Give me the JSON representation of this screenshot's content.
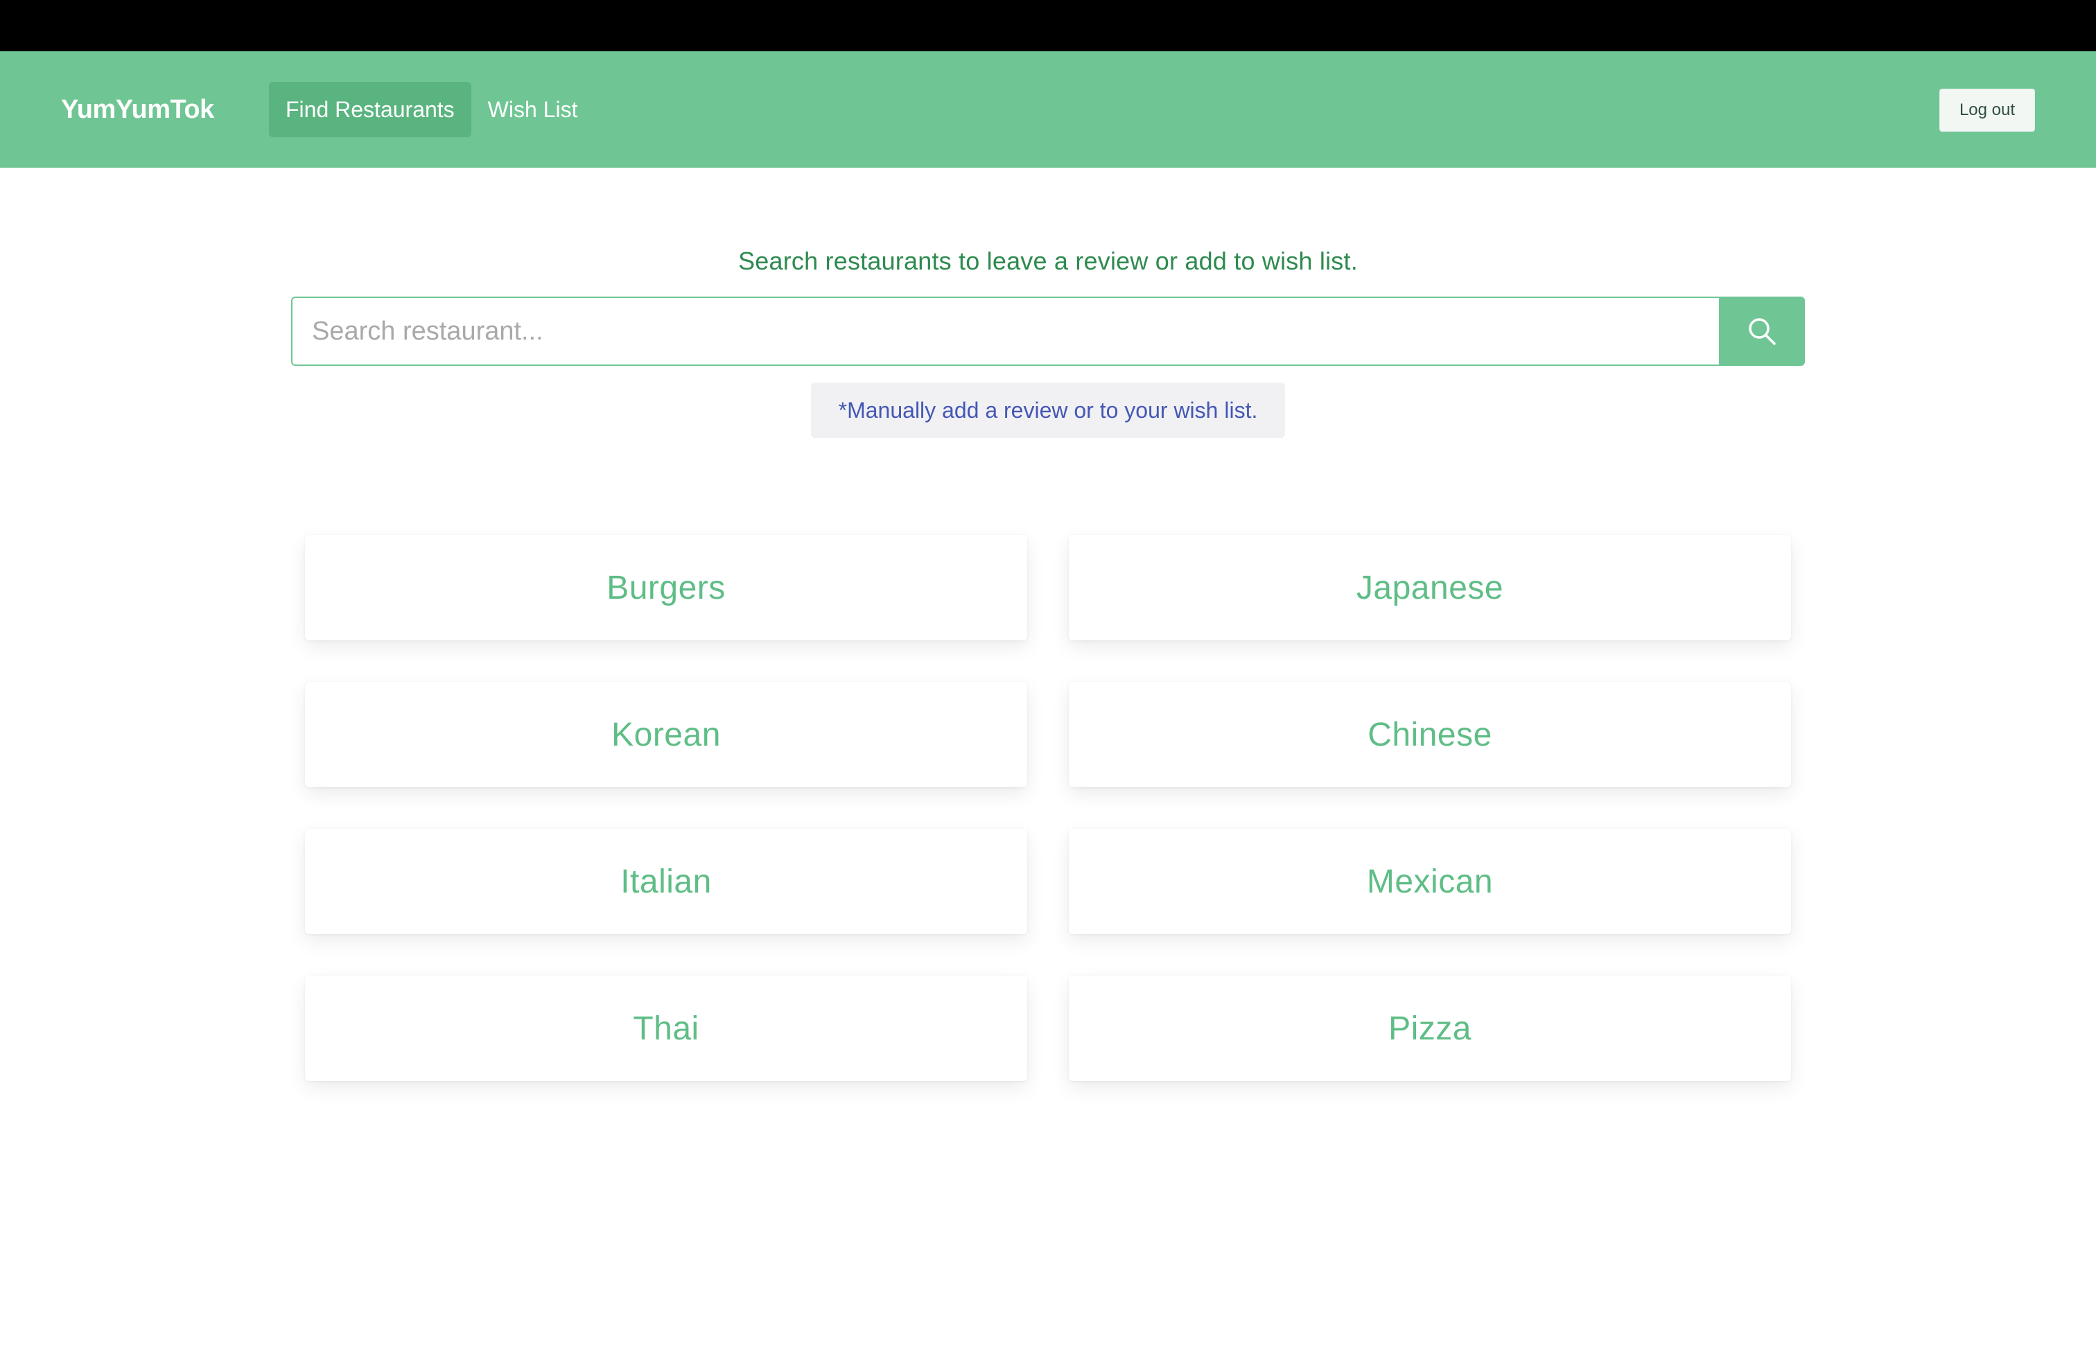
{
  "navbar": {
    "brand": "YumYumTok",
    "links": [
      {
        "label": "Find Restaurants",
        "active": true
      },
      {
        "label": "Wish List",
        "active": false
      }
    ],
    "logout_label": "Log out",
    "color": "#6fc694"
  },
  "main": {
    "subtitle": "Search restaurants to leave a review or add to wish list.",
    "search": {
      "placeholder": "Search restaurant...",
      "value": "",
      "button_icon": "search-icon"
    },
    "manual_note": "*Manually add a review or to your wish list.",
    "categories": [
      {
        "label": "Burgers"
      },
      {
        "label": "Japanese"
      },
      {
        "label": "Korean"
      },
      {
        "label": "Chinese"
      },
      {
        "label": "Italian"
      },
      {
        "label": "Mexican"
      },
      {
        "label": "Thai"
      },
      {
        "label": "Pizza"
      }
    ]
  }
}
